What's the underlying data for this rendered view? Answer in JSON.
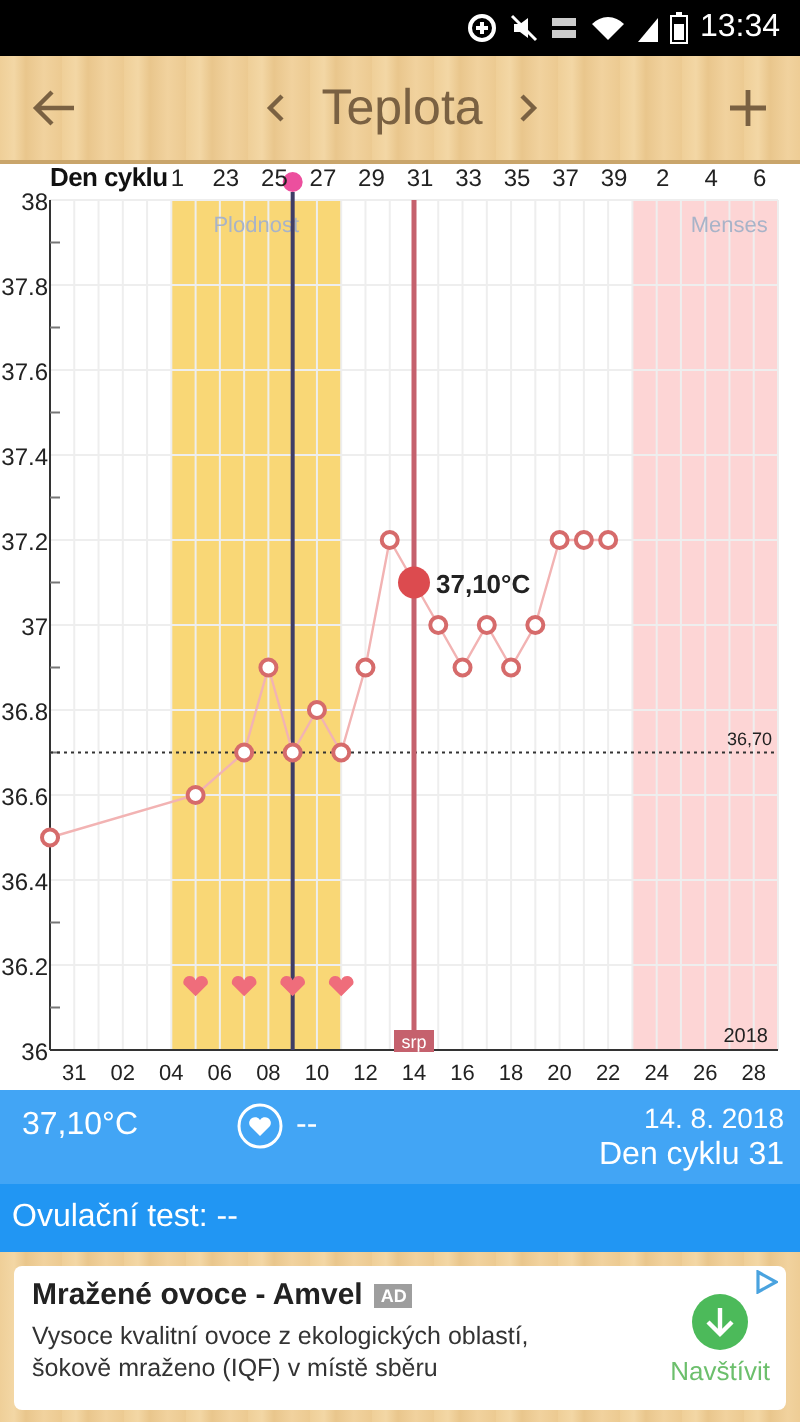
{
  "status_bar": {
    "time": "13:34"
  },
  "header": {
    "title": "Teplota"
  },
  "chart": {
    "chart_data": {
      "type": "line",
      "categories": [
        null,
        "31",
        null,
        "02",
        null,
        "04",
        null,
        "06",
        null,
        "08",
        null,
        "10",
        null,
        "12",
        null,
        "14",
        null,
        "16",
        null,
        "18",
        null,
        "20",
        null,
        "22",
        null,
        "24",
        null,
        "26",
        null,
        "28",
        null
      ],
      "grid": true,
      "series": [
        {
          "color": "#d66b6b",
          "marker": "circle",
          "values": [
            36.5,
            null,
            null,
            null,
            null,
            null,
            36.6,
            null,
            36.7,
            36.9,
            36.7,
            36.8,
            36.7,
            36.9,
            37.2,
            37.1,
            37.0,
            36.9,
            37.0,
            36.9,
            37.0,
            37.2,
            37.2,
            37.2,
            null,
            null,
            null,
            null,
            null,
            null,
            null
          ]
        },
        {
          "type": "scatter",
          "color": "#ef6d7b",
          "values": [
            null,
            null,
            null,
            null,
            null,
            null,
            36.15,
            null,
            36.15,
            null,
            36.15,
            null,
            36.15,
            null,
            null,
            null,
            null,
            null,
            null,
            null,
            null,
            null,
            null,
            null,
            null,
            null,
            null,
            null,
            null,
            null,
            null
          ]
        }
      ],
      "ylim": [
        36,
        38
      ],
      "yticks": [
        {
          "value": 36,
          "label": "36"
        },
        {
          "value": 36.2,
          "label": "36.2"
        },
        {
          "value": 36.4,
          "label": "36.4"
        },
        {
          "value": 36.6,
          "label": "36.6"
        },
        {
          "value": 36.8,
          "label": "36.8"
        },
        {
          "value": 37,
          "label": "37"
        },
        {
          "value": 37.2,
          "label": "37.2"
        },
        {
          "value": 37.4,
          "label": "37.4"
        },
        {
          "value": 37.6,
          "label": "37.6"
        },
        {
          "value": 37.8,
          "label": "37.8"
        },
        {
          "value": 38,
          "label": "38"
        }
      ],
      "ref_lines": [
        {
          "axis": "y",
          "value": 36.7,
          "label": "36,70",
          "color": "#333333"
        },
        {
          "axis": "x",
          "value": "14",
          "label": "srp",
          "color": "#c5616d"
        }
      ],
      "annotations": [
        {
          "x": "14",
          "y": 37.1,
          "text": "37,10°C"
        },
        {
          "text": "2018"
        }
      ]
    },
    "bands": [
      {
        "label": "Plodnost",
        "color": "#f9d776"
      },
      {
        "label": "Menses",
        "color": "#fdd5d5"
      }
    ],
    "ovulation_line": {
      "color": "#3f3d66"
    },
    "cycle_axis": {
      "title": "Den cyklu",
      "labels": [
        "1",
        "23",
        "25",
        "27",
        "29",
        "31",
        "33",
        "35",
        "37",
        "39",
        "2",
        "4",
        "6"
      ]
    }
  },
  "info": {
    "temperature": "37,10°C",
    "intercourse": "--",
    "date": "14. 8. 2018",
    "cycle_day": "Den cyklu 31"
  },
  "ovulation_test": {
    "label": "Ovulační test: --"
  },
  "ad": {
    "title": "Mražené ovoce - Amvel",
    "badge": "AD",
    "text": "Vysoce kvalitní ovoce z ekologických oblastí, šokově mraženo (IQF) v místě sběru",
    "button": "Navštívit"
  }
}
